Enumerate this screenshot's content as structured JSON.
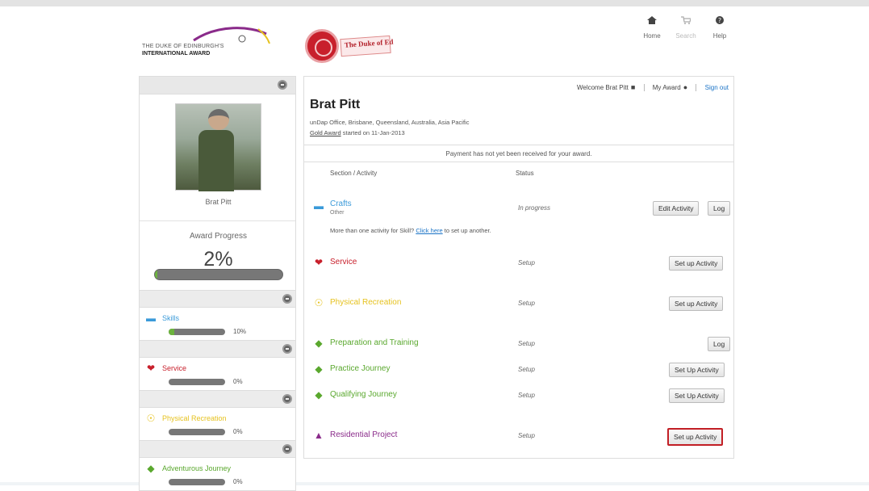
{
  "header": {
    "logo_line1": "THE DUKE OF EDINBURGH'S",
    "logo_line2": "INTERNATIONAL AWARD",
    "banner_title": "The Duke of Ed",
    "nav": [
      {
        "label": "Home",
        "icon": "home-icon"
      },
      {
        "label": "Search",
        "icon": "cart-icon"
      },
      {
        "label": "Help",
        "icon": "help-icon"
      }
    ]
  },
  "sidebar": {
    "participant_name": "Brat Pitt",
    "award_progress_label": "Award Progress",
    "award_progress_value": "2%",
    "award_progress_fraction": 0.02,
    "sections": [
      {
        "name": "Skills",
        "icon": "speech-bubble-icon",
        "color": "#3a9ad9",
        "pct": "10%",
        "fraction": 0.1
      },
      {
        "name": "Service",
        "icon": "hands-icon",
        "color": "#c8202c",
        "pct": "0%",
        "fraction": 0.0
      },
      {
        "name": "Physical Recreation",
        "icon": "physical-recreation-icon",
        "color": "#e6c21f",
        "pct": "0%",
        "fraction": 0.0
      },
      {
        "name": "Adventurous Journey",
        "icon": "journey-icon",
        "color": "#5aa82e",
        "pct": "0%",
        "fraction": 0.0
      }
    ]
  },
  "main": {
    "welcome": "Welcome Brat Pitt",
    "my_award": "My Award",
    "sign_out": "Sign out",
    "name": "Brat Pitt",
    "location": "unDap Office, Brisbane, Queensland, Australia, Asia Pacific",
    "award_level": "Gold Award",
    "started": "started on 11-Jan-2013",
    "payment_notice": "Payment has not yet been received for your award.",
    "col_section": "Section / Activity",
    "col_status": "Status",
    "more_text": "More than one activity for Skill?",
    "more_link": "Click here",
    "more_suffix": "to set up another.",
    "activities": [
      {
        "name": "Crafts",
        "sub": "Other",
        "status": "In progress",
        "color": "#3a9ad9",
        "buttons": [
          "Edit Activity",
          "Log"
        ]
      },
      {
        "name": "Service",
        "status": "Setup",
        "color": "#c8202c",
        "buttons": [
          "Set up Activity"
        ]
      },
      {
        "name": "Physical Recreation",
        "status": "Setup",
        "color": "#e6c21f",
        "buttons": [
          "Set up Activity"
        ]
      },
      {
        "name": "Preparation and Training",
        "status": "Setup",
        "color": "#5aa82e",
        "buttons": [
          "Log"
        ]
      },
      {
        "name": "Practice Journey",
        "status": "Setup",
        "color": "#5aa82e",
        "buttons": [
          "Set Up Activity"
        ]
      },
      {
        "name": "Qualifying Journey",
        "status": "Setup",
        "color": "#5aa82e",
        "buttons": [
          "Set Up Activity"
        ]
      },
      {
        "name": "Residential Project",
        "status": "Setup",
        "color": "#8a2b8a",
        "buttons": [
          "Set up Activity"
        ]
      }
    ]
  }
}
